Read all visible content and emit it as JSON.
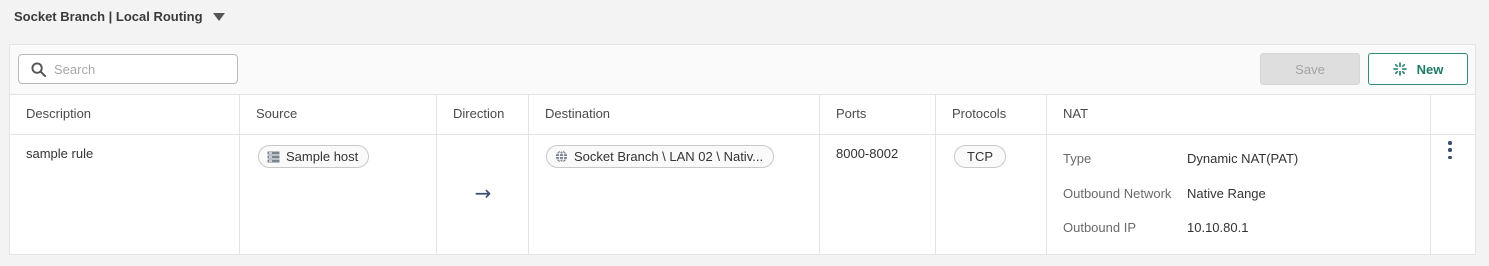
{
  "header": {
    "title": "Socket Branch | Local Routing"
  },
  "toolbar": {
    "search_placeholder": "Search",
    "save_label": "Save",
    "new_label": "New"
  },
  "table": {
    "columns": [
      "Description",
      "Source",
      "Direction",
      "Destination",
      "Ports",
      "Protocols",
      "NAT"
    ],
    "rows": [
      {
        "description": "sample rule",
        "source": "Sample host",
        "direction": "→",
        "destination": "Socket Branch \\ LAN 02 \\ Nativ...",
        "ports": "8000-8002",
        "protocol": "TCP",
        "nat": [
          {
            "key": "Type",
            "value": "Dynamic NAT(PAT)"
          },
          {
            "key": "Outbound Network",
            "value": "Native Range"
          },
          {
            "key": "Outbound IP",
            "value": "10.10.80.1"
          }
        ]
      }
    ]
  },
  "colors": {
    "accent": "#1e7a68",
    "border": "#e4e4e4",
    "disabled": "#dedede"
  },
  "icons": [
    "chevron-down-icon",
    "search-icon",
    "sparkle-icon",
    "host-icon",
    "globe-icon",
    "arrow-right-icon",
    "more-vertical-icon"
  ]
}
